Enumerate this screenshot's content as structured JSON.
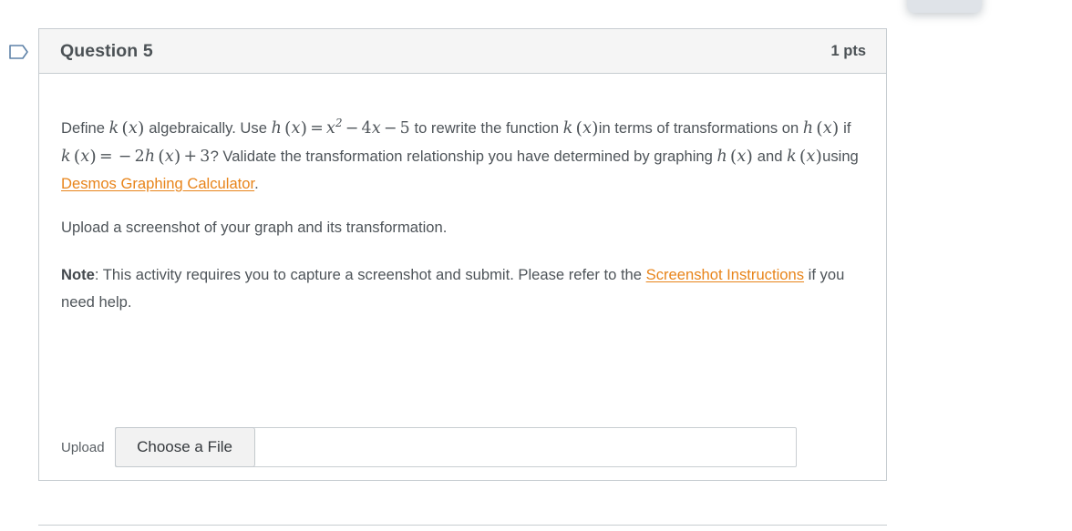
{
  "question": {
    "title": "Question 5",
    "points": "1 pts"
  },
  "icons": {
    "flag": "flag-bookmark-icon"
  },
  "body": {
    "para1": {
      "seg1": "Define ",
      "math_k1": "k (x)",
      "seg2": " algebraically.  Use ",
      "math_h_def": "h (x) = x² − 4x − 5",
      "seg3": " to  rewrite the function ",
      "math_k2": "k (x)",
      "seg4": "in terms of transformations on ",
      "math_h1": "h (x)",
      "seg5": " if ",
      "math_k_def": "k (x) = −2h (x) + 3",
      "seg6": "? Validate the transformation relationship you have determined by graphing ",
      "math_h2": "h (x)",
      "seg7": " and ",
      "math_k3": "k (x)",
      "seg8": "using ",
      "link_desmos": "Desmos Graphing Calculator",
      "seg9": "."
    },
    "para2": "Upload a screenshot of your graph and its transformation.",
    "para3": {
      "note_label": "Note",
      "seg1": ": This activity requires you to capture a screenshot and submit. Please refer to the ",
      "link_screenshot": "Screenshot Instructions",
      "seg2": " if you need help."
    }
  },
  "upload": {
    "label": "Upload",
    "button_label": "Choose a File",
    "file_value": ""
  },
  "colors": {
    "link": "#e8841a",
    "text": "#4e5459",
    "header_bg": "#f5f5f5",
    "border": "#c7cdd1",
    "flag_icon": "#5e82a8"
  }
}
